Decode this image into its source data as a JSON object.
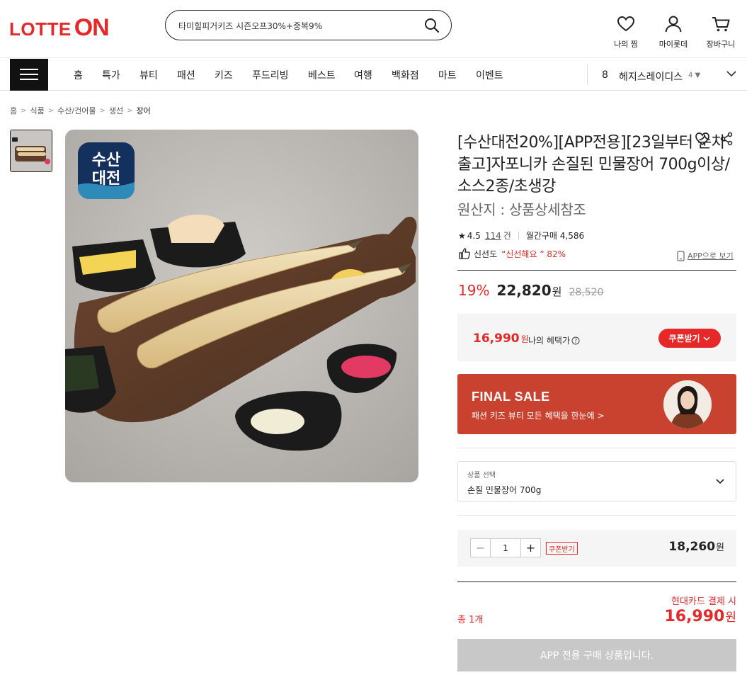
{
  "header": {
    "logo_lotte": "LOTTE",
    "logo_on": "ON",
    "search_value": "타미힐피거키즈 시즌오프30%+중복9%",
    "wish_label": "나의 찜",
    "mypage_label": "마이롯데",
    "cart_label": "장바구니"
  },
  "gnb": {
    "items": [
      "홈",
      "특가",
      "뷰티",
      "패션",
      "키즈",
      "푸드리빙",
      "베스트",
      "여행",
      "백화점",
      "마트",
      "이벤트"
    ],
    "rank_number": "8",
    "rank_keyword": "헤지스레이디스",
    "rank_delta": "4 ▼"
  },
  "breadcrumb": [
    "홈",
    "식품",
    "수산/건어물",
    "생선",
    "장어"
  ],
  "image": {
    "badge_line1": "수산",
    "badge_line2": "대전"
  },
  "product": {
    "title": "[수산대전20%][APP전용][23일부터 순차출고]자포니카 손질된 민물장어 700g이상/소스2종/초생강",
    "origin": "원산지 : 상품상세참조",
    "rating": "4.5",
    "review_count": "114",
    "review_unit": "건",
    "monthly_purchase": "월간구매 4,586",
    "freshness_label": "신선도",
    "freshness_value": "“신선해요 ” 82%",
    "app_view": "APP으로 보기"
  },
  "price": {
    "discount_rate": "19%",
    "sale_price": "22,820",
    "won": "원",
    "original_price": "28,520"
  },
  "benefit": {
    "price": "16,990",
    "won": "원",
    "label": "나의 혜택가",
    "coupon_button": "쿠폰받기"
  },
  "banner": {
    "title": "FINAL SALE",
    "subtitle": "패션 키즈 뷰티 모든 혜택을 한눈에 >"
  },
  "option": {
    "label": "상품 선택",
    "value": "손질 민물장어 700g"
  },
  "quantity": {
    "value": "1",
    "coupon_tag": "쿠폰받기",
    "price": "18,260",
    "won": "원"
  },
  "total": {
    "card_label": "현대카드 결제 시",
    "count_label": "총 1개",
    "price": "16,990",
    "won": "원"
  },
  "buy_button": "APP 전용 구매 상품입니다.",
  "colors": {
    "brand_red": "#e62828",
    "banner_bg": "#c9412f",
    "disabled_button": "#c8c8c8"
  }
}
